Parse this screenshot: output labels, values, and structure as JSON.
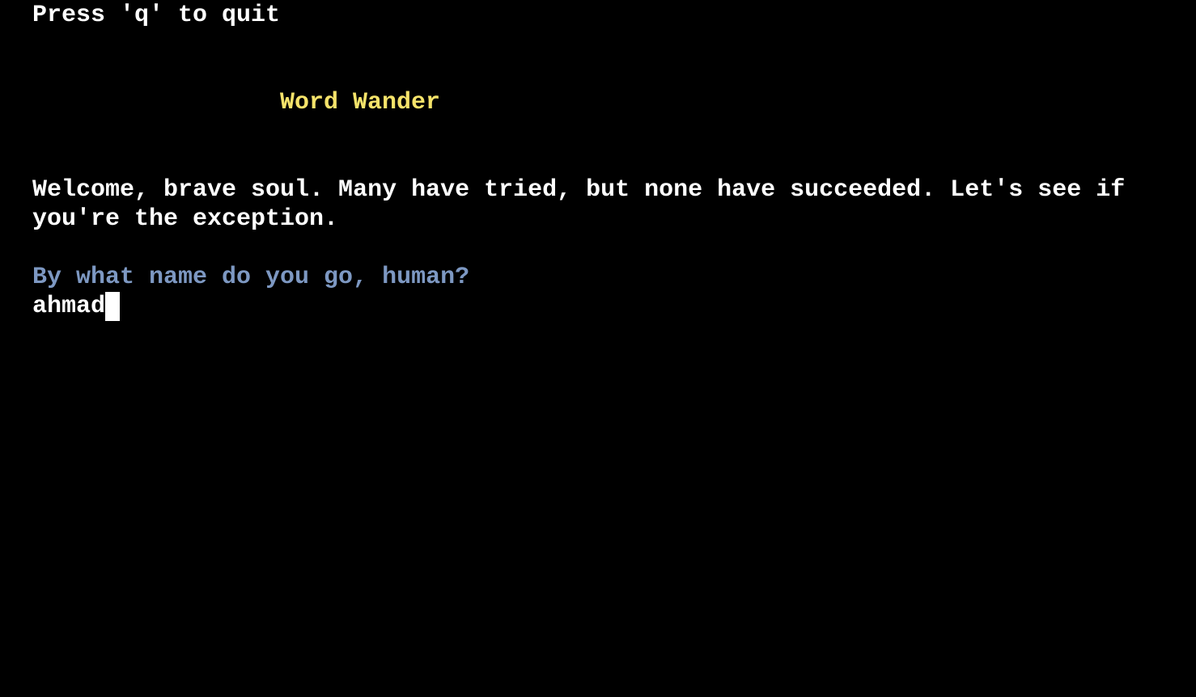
{
  "terminal": {
    "quit_hint": "Press 'q' to quit",
    "title": "Word Wander",
    "welcome_line_1": "Welcome, brave soul. Many have tried, but none have succeeded. Let's see if",
    "welcome_line_2": "you're the exception.",
    "prompt": "By what name do you go, human?",
    "input_value": "ahmad"
  },
  "colors": {
    "background": "#000000",
    "text": "#ffffff",
    "title": "#f5e36a",
    "prompt": "#7d98c2"
  }
}
